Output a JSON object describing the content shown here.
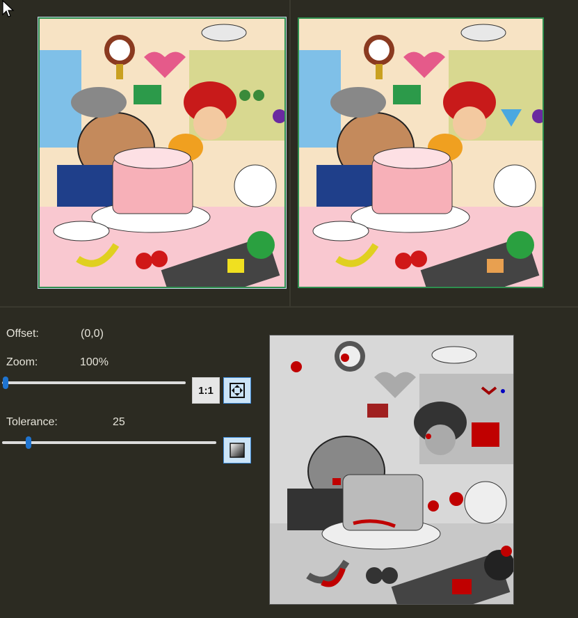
{
  "offset": {
    "label": "Offset:",
    "value": "(0,0)"
  },
  "zoom": {
    "label": "Zoom:",
    "value": "100%",
    "slider_fraction": 0.0,
    "one_to_one_label": "1:1",
    "fit_icon": "fit-to-window-icon"
  },
  "tolerance": {
    "label": "Tolerance:",
    "value": "25",
    "slider_fraction": 0.11,
    "contrast_icon": "gradient-contrast-icon"
  },
  "colors": {
    "background": "#2c2b22",
    "frame": "#2f8f4f",
    "slider_thumb": "#1f74d0",
    "diff_highlight": "#c00000"
  }
}
